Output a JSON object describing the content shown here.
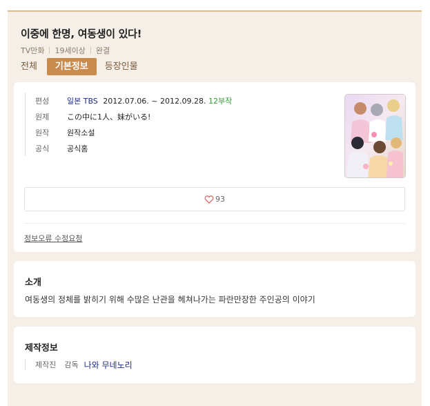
{
  "header": {
    "title": "이중에 한명, 여동생이 있다!",
    "meta": [
      "TV만화",
      "19세이상",
      "완결"
    ]
  },
  "tabs": [
    {
      "label": "전체",
      "active": false
    },
    {
      "label": "기본정보",
      "active": true
    },
    {
      "label": "등장인물",
      "active": false
    }
  ],
  "info": {
    "broadcast_label": "편성",
    "broadcast_channel": "일본 TBS",
    "broadcast_dates": "2012.07.06. ~ 2012.09.28.",
    "broadcast_episodes": "12부작",
    "original_title_label": "원제",
    "original_title": "この中に1人、妹がいる!",
    "source_label": "원작",
    "source": "원작소설",
    "official_label": "공식",
    "official": "공식홈"
  },
  "like_count": "93",
  "report_link": "정보오류 수정요청",
  "intro": {
    "title": "소개",
    "text": "여동생의 정체를 밝히기 위해 수많은 난관을 헤쳐나가는 파란만장한 주인공의 이야기"
  },
  "production": {
    "title": "제작정보",
    "staff_label": "제작진",
    "role": "감독",
    "name": "나와 무네노리"
  },
  "colors": {
    "accent": "#c98a4e",
    "link": "#1b2a86",
    "episodes_green": "#2e9b2e",
    "background": "#f5efe8"
  },
  "icons": {
    "like": "heart-outline-icon"
  }
}
